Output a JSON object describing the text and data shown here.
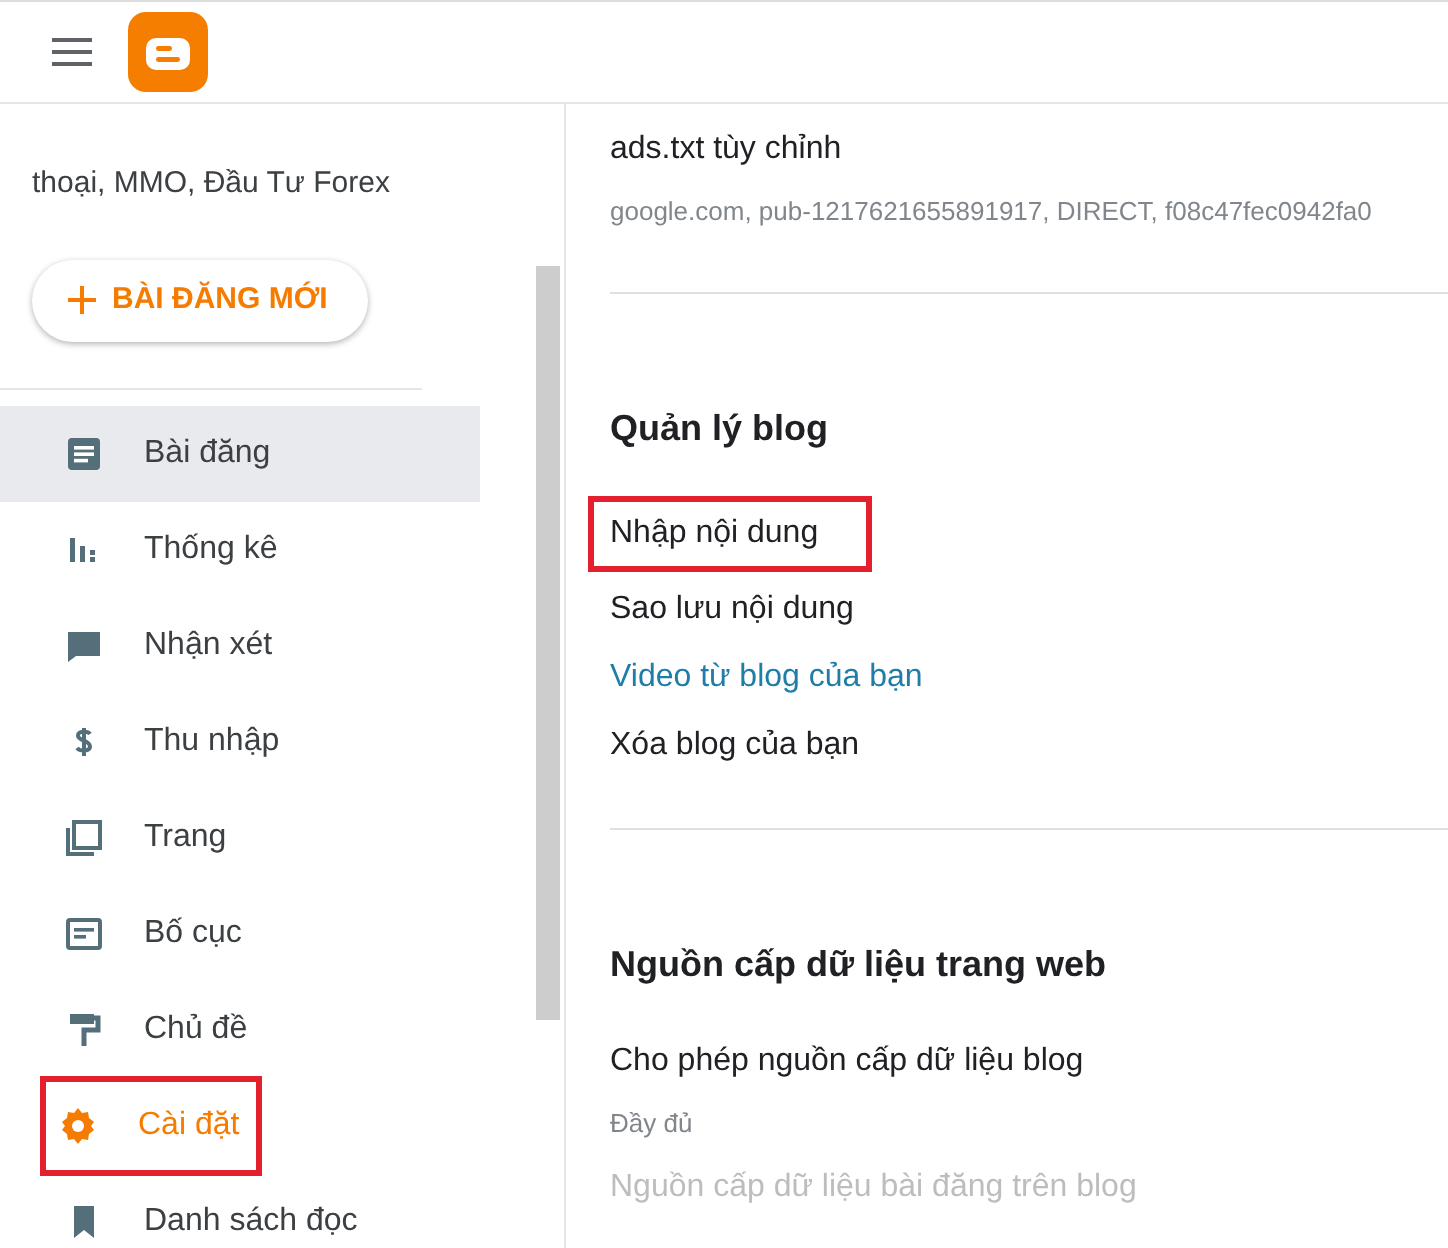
{
  "sidebar": {
    "blog_description": "thoại, MMO, Đầu Tư Forex",
    "new_post_button": "BÀI ĐĂNG MỚI",
    "items": [
      {
        "label": "Bài đăng",
        "selected": false,
        "hovered": true,
        "highlighted": false
      },
      {
        "label": "Thống kê",
        "selected": false,
        "hovered": false,
        "highlighted": false
      },
      {
        "label": "Nhận xét",
        "selected": false,
        "hovered": false,
        "highlighted": false
      },
      {
        "label": "Thu nhập",
        "selected": false,
        "hovered": false,
        "highlighted": false
      },
      {
        "label": "Trang",
        "selected": false,
        "hovered": false,
        "highlighted": false
      },
      {
        "label": "Bố cục",
        "selected": false,
        "hovered": false,
        "highlighted": false
      },
      {
        "label": "Chủ đề",
        "selected": false,
        "hovered": false,
        "highlighted": false
      },
      {
        "label": "Cài đặt",
        "selected": true,
        "hovered": false,
        "highlighted": true
      },
      {
        "label": "Danh sách đọc",
        "selected": false,
        "hovered": false,
        "highlighted": false
      }
    ]
  },
  "sections": [
    {
      "items": [
        {
          "kind": "setting",
          "label": "ads.txt tùy chỉnh",
          "value": "google.com, pub-1217621655891917, DIRECT, f08c47fec0942fa0",
          "disabled": false,
          "highlighted": false
        }
      ]
    },
    {
      "heading": "Quản lý blog",
      "items": [
        {
          "kind": "action",
          "label": "Nhập nội dung",
          "disabled": false,
          "highlighted": true
        },
        {
          "kind": "action",
          "label": "Sao lưu nội dung",
          "disabled": false,
          "highlighted": false
        },
        {
          "kind": "link",
          "label": "Video từ blog của bạn",
          "disabled": false,
          "highlighted": false
        },
        {
          "kind": "action",
          "label": "Xóa blog của bạn",
          "disabled": false,
          "highlighted": false
        }
      ]
    },
    {
      "heading": "Nguồn cấp dữ liệu trang web",
      "items": [
        {
          "kind": "setting",
          "label": "Cho phép nguồn cấp dữ liệu blog",
          "value": "Đầy đủ",
          "disabled": false,
          "highlighted": false
        },
        {
          "kind": "action",
          "label": "Nguồn cấp dữ liệu bài đăng trên blog",
          "disabled": true,
          "highlighted": false
        }
      ]
    }
  ]
}
